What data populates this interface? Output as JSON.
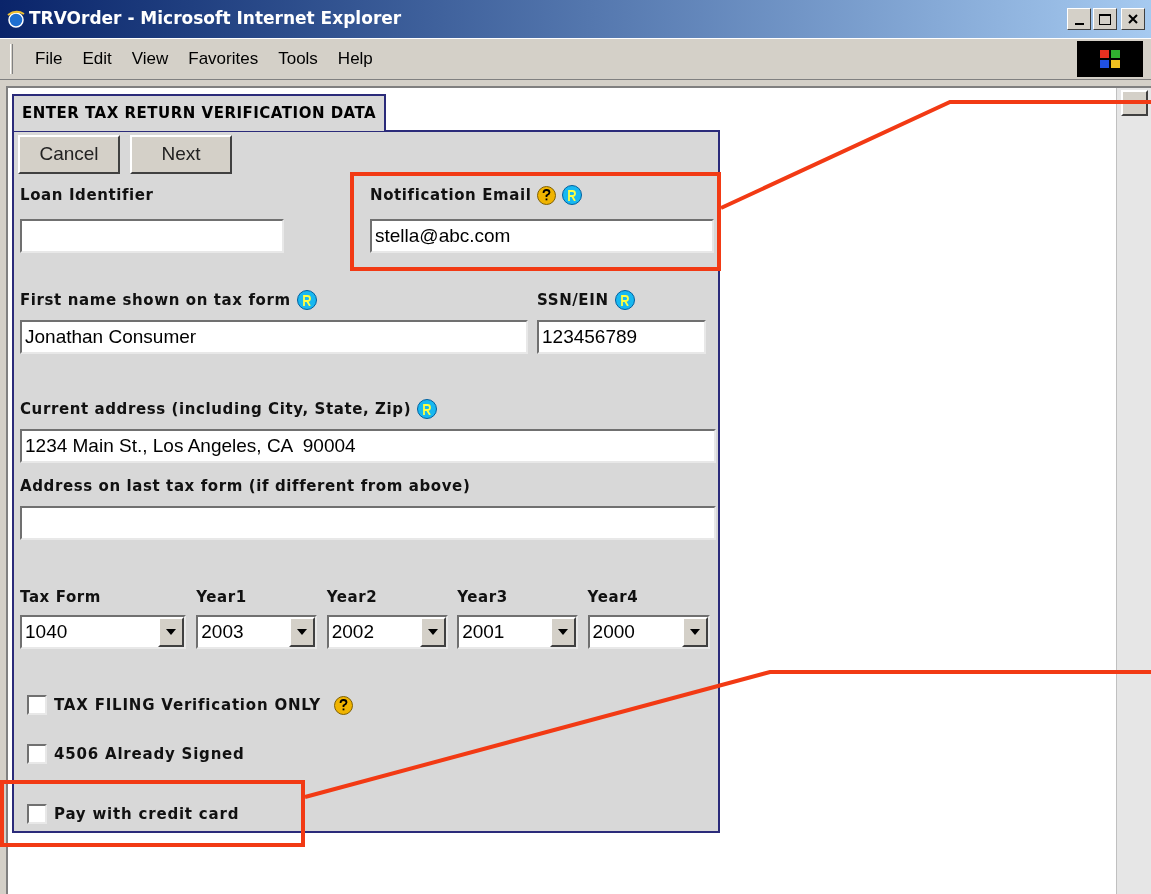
{
  "window": {
    "title": "TRVOrder - Microsoft Internet Explorer"
  },
  "menu": [
    "File",
    "Edit",
    "View",
    "Favorites",
    "Tools",
    "Help"
  ],
  "form": {
    "title": "ENTER TAX RETURN VERIFICATION DATA",
    "buttons": [
      "Cancel",
      "Next"
    ],
    "rows": [
      [
        {
          "label": "Loan Identifier",
          "help": false,
          "required": false
        },
        {
          "label": "Notification Email",
          "help": true,
          "required": true,
          "value": "stella@abc.com"
        }
      ],
      [
        {
          "label": "First name shown on tax form",
          "help": false,
          "required": true,
          "value": "Jonathan Consumer"
        },
        {
          "label": "SSN/EIN",
          "help": false,
          "required": true,
          "value": "123456789"
        }
      ],
      [
        {
          "label": "Current address (including City, State, Zip)",
          "help": false,
          "required": true,
          "value": "1234 Main St., Los Angeles, CA  90004"
        }
      ],
      [
        {
          "label": "Address on last tax form (if different from above)",
          "help": false,
          "required": false
        }
      ]
    ],
    "selects": [
      {
        "label": "Tax Form",
        "value": "1040"
      },
      {
        "label": "Year1",
        "value": "2003"
      },
      {
        "label": "Year2",
        "value": "2002"
      },
      {
        "label": "Year3",
        "value": "2001"
      },
      {
        "label": "Year4",
        "value": "2000"
      }
    ],
    "checkboxes": [
      {
        "label": "TAX FILING Verification ONLY",
        "checked": false,
        "help": true
      },
      {
        "label": "4506 Already Signed",
        "checked": false,
        "help": false
      },
      {
        "label": "Pay with credit card",
        "checked": false,
        "help": false
      }
    ]
  }
}
